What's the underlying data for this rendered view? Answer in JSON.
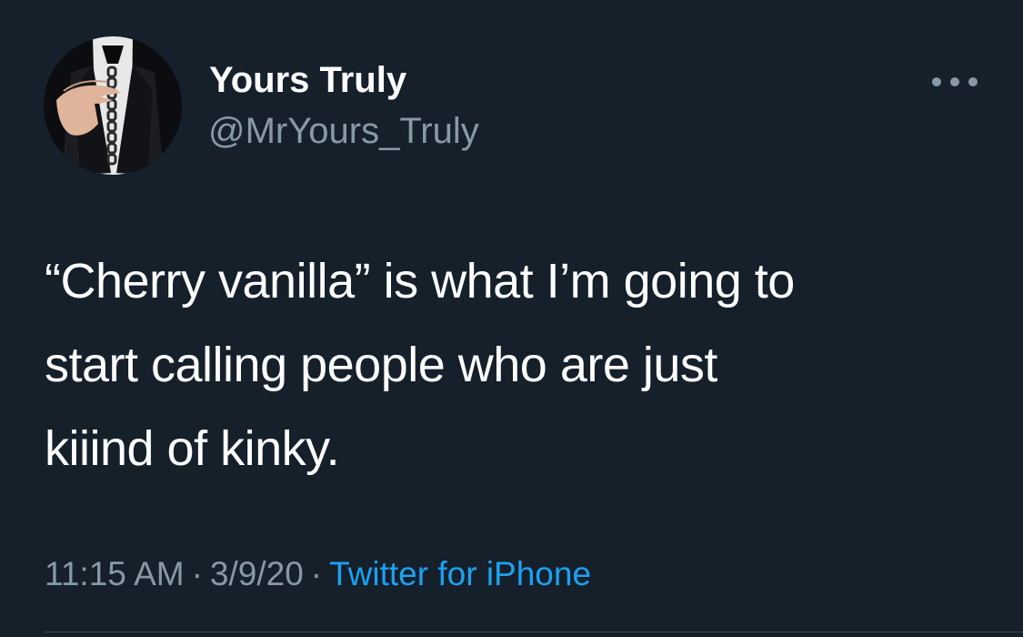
{
  "tweet": {
    "author": {
      "display_name": "Yours Truly",
      "handle": "@MrYours_Truly",
      "avatar_icon": "profile-photo"
    },
    "more_icon": "more-horizontal-icon",
    "text_lines": [
      "“Cherry vanilla” is what I’m going to",
      "start calling people who are just",
      "kiiind of kinky."
    ],
    "meta": {
      "time": "11:15 AM",
      "separator": "·",
      "date": "3/9/20",
      "source": "Twitter for iPhone"
    }
  },
  "colors": {
    "background": "#15202b",
    "text_primary": "#ffffff",
    "text_secondary": "#8899a6",
    "link": "#1da1f2",
    "divider": "#38444d"
  }
}
